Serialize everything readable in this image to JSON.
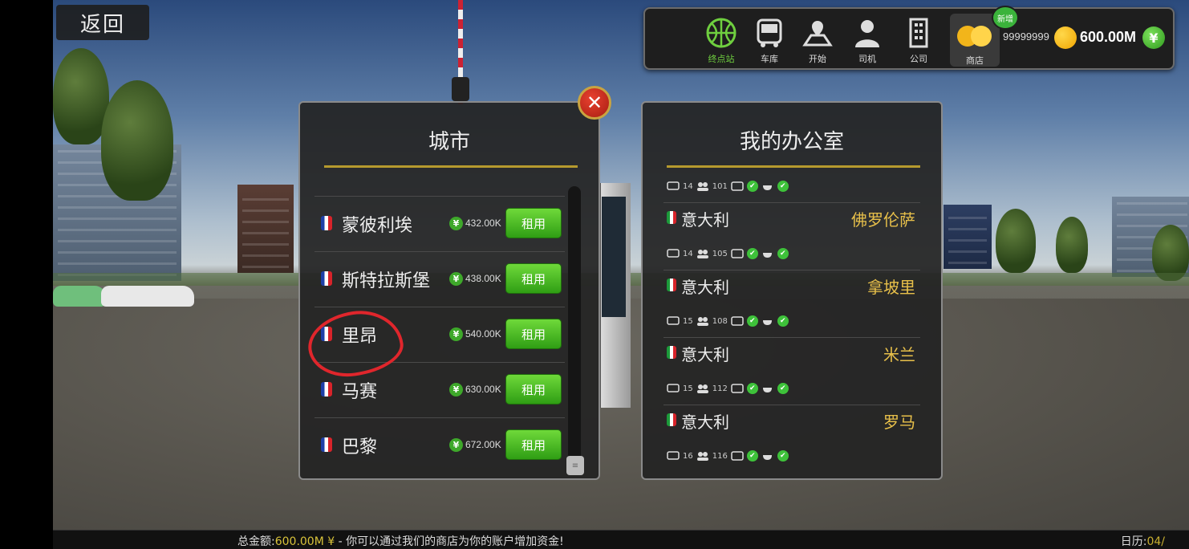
{
  "back_button": "返回",
  "toolbar": {
    "items": [
      {
        "label": "终点站",
        "icon": "basketball-icon",
        "active": true
      },
      {
        "label": "车库",
        "icon": "bus-icon"
      },
      {
        "label": "开始",
        "icon": "map-pin-icon"
      },
      {
        "label": "司机",
        "icon": "driver-icon"
      },
      {
        "label": "公司",
        "icon": "building-icon"
      }
    ],
    "shop_label": "商店",
    "new_badge": "新增",
    "gold": "99999999",
    "money": "600.00M",
    "yen_symbol": "¥"
  },
  "city_panel": {
    "title": "城市",
    "rent_label": "租用",
    "currency_symbol": "¥",
    "cities": [
      {
        "name": "蒙彼利埃",
        "price": "432.00K"
      },
      {
        "name": "斯特拉斯堡",
        "price": "438.00K"
      },
      {
        "name": "里昂",
        "price": "540.00K"
      },
      {
        "name": "马赛",
        "price": "630.00K"
      },
      {
        "name": "巴黎",
        "price": "672.00K"
      }
    ]
  },
  "office_panel": {
    "title": "我的办公室",
    "stats": [
      {
        "buses": "14",
        "staff": "101"
      },
      {
        "buses": "14",
        "staff": "105"
      },
      {
        "buses": "15",
        "staff": "108"
      },
      {
        "buses": "15",
        "staff": "112"
      },
      {
        "buses": "16",
        "staff": "116"
      }
    ],
    "offices": [
      {
        "country": "意大利",
        "city": "佛罗伦萨"
      },
      {
        "country": "意大利",
        "city": "拿坡里"
      },
      {
        "country": "意大利",
        "city": "米兰"
      },
      {
        "country": "意大利",
        "city": "罗马"
      }
    ]
  },
  "ticker": {
    "prefix": "总金额:",
    "money": "600.00M ¥",
    "message": " - 你可以通过我们的商店为你的账户增加资金!",
    "calendar_label": "日历:",
    "calendar_value": "04/"
  },
  "colors": {
    "accent_green": "#3ea82a",
    "gold_text": "#e8c04a",
    "title_rule": "#b59a2e",
    "annotation_red": "#e0262c"
  }
}
